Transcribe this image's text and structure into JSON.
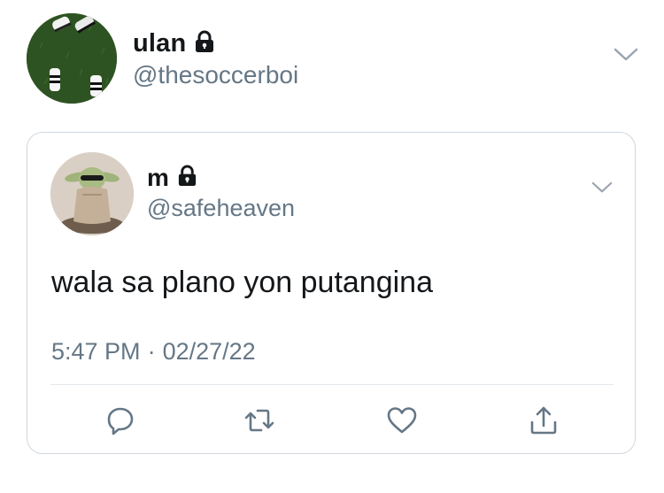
{
  "outer_tweet": {
    "display_name": "ulan",
    "handle": "@thesoccerboi",
    "locked_icon": "lock-icon",
    "menu_icon": "chevron-down-icon"
  },
  "quoted_tweet": {
    "display_name": "m",
    "handle": "@safeheaven",
    "locked_icon": "lock-icon",
    "menu_icon": "chevron-down-icon",
    "text": "wala sa plano yon putangina",
    "time": "5:47 PM",
    "separator": "·",
    "date": "02/27/22",
    "actions": [
      {
        "name": "reply",
        "icon": "reply-icon"
      },
      {
        "name": "retweet",
        "icon": "retweet-icon"
      },
      {
        "name": "like",
        "icon": "heart-icon"
      },
      {
        "name": "share",
        "icon": "share-icon"
      }
    ]
  },
  "colors": {
    "text_primary": "#14171a",
    "text_secondary": "#657786",
    "border": "#d0d7dd",
    "divider": "#e1e8ed"
  }
}
